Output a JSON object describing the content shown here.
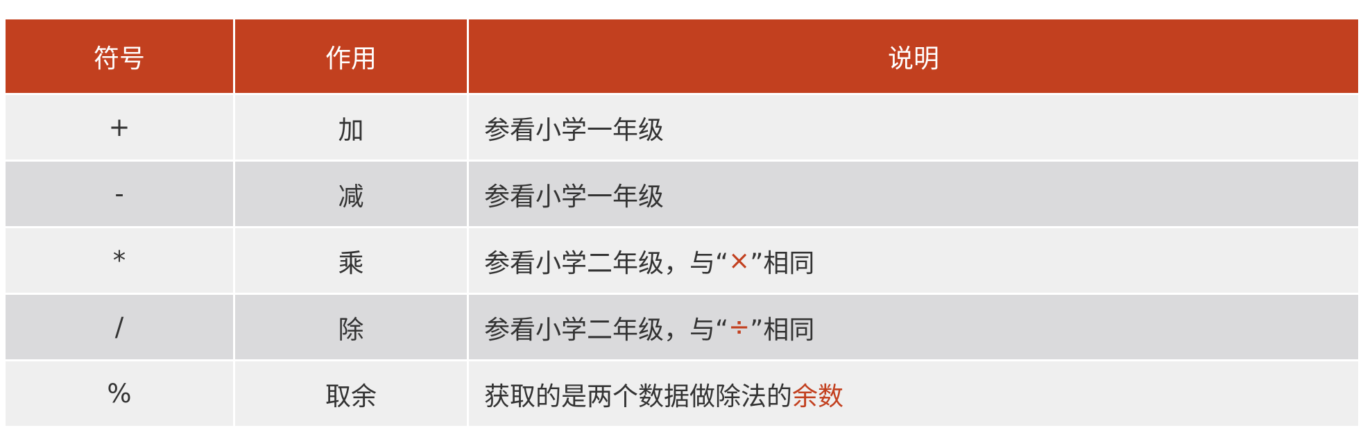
{
  "table": {
    "headers": [
      "符号",
      "作用",
      "说明"
    ],
    "accent_color": "#c2401f",
    "rows": [
      {
        "symbol": "+",
        "action": "加",
        "desc_before": "参看小学一年级",
        "desc_accent": "",
        "desc_after": ""
      },
      {
        "symbol": "-",
        "action": "减",
        "desc_before": "参看小学一年级",
        "desc_accent": "",
        "desc_after": ""
      },
      {
        "symbol": "*",
        "action": "乘",
        "desc_before": "参看小学二年级，与“",
        "desc_accent": "×",
        "desc_after": "”相同"
      },
      {
        "symbol": "/",
        "action": "除",
        "desc_before": "参看小学二年级，与“",
        "desc_accent": "÷",
        "desc_after": "”相同"
      },
      {
        "symbol": "%",
        "action": "取余",
        "desc_before": "获取的是两个数据做除法的",
        "desc_accent": "余数",
        "desc_after": ""
      }
    ]
  }
}
